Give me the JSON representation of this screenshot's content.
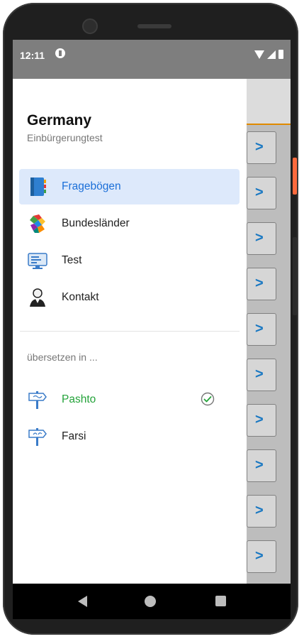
{
  "status_bar": {
    "time": "12:11"
  },
  "drawer": {
    "title": "Germany",
    "subtitle": "Einbürgerungtest",
    "items": [
      {
        "label": "Fragebögen",
        "icon": "notebook-icon",
        "active": true
      },
      {
        "label": "Bundesländer",
        "icon": "colorful-map-icon",
        "active": false
      },
      {
        "label": "Test",
        "icon": "computer-test-icon",
        "active": false
      },
      {
        "label": "Kontakt",
        "icon": "person-contact-icon",
        "active": false
      }
    ],
    "section_label": "übersetzen in ...",
    "languages": [
      {
        "label": "Pashto",
        "icon": "signpost-icon",
        "selected": true
      },
      {
        "label": "Farsi",
        "icon": "signpost-icon",
        "selected": false
      }
    ]
  },
  "background_list": {
    "chevron": ">"
  },
  "colors": {
    "accent": "#1b6fd8",
    "active_bg": "#dde9fb",
    "selected_lang": "#24a33a",
    "toolbar_line": "#e08a00"
  }
}
